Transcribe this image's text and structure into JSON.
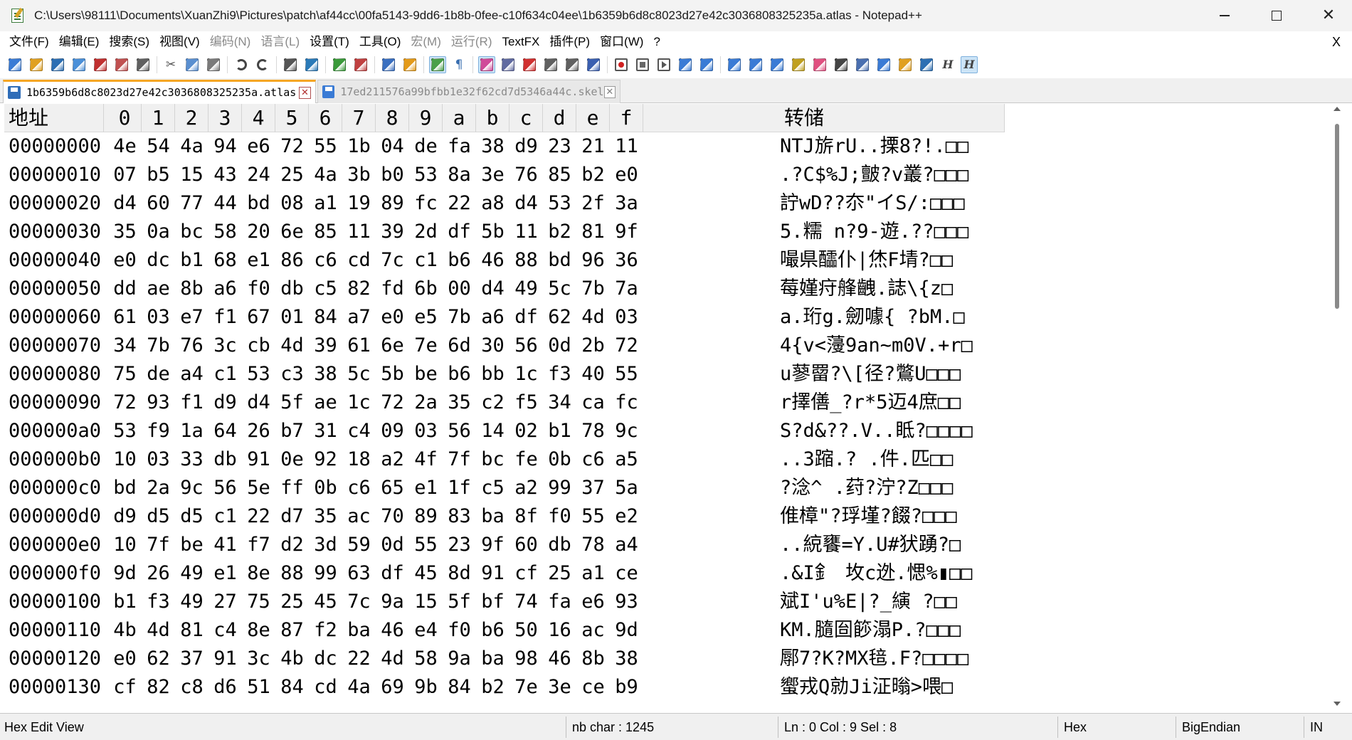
{
  "window": {
    "title": "C:\\Users\\98111\\Documents\\XuanZhi9\\Pictures\\patch\\af44cc\\00fa5143-9dd6-1b8b-0fee-c10f634c04ee\\1b6359b6d8c8023d27e42c3036808325235a.atlas - Notepad++",
    "minimize_glyph": "",
    "close_glyph": "✕"
  },
  "menu": {
    "items": [
      {
        "label": "文件(F)",
        "enabled": true
      },
      {
        "label": "编辑(E)",
        "enabled": true
      },
      {
        "label": "搜索(S)",
        "enabled": true
      },
      {
        "label": "视图(V)",
        "enabled": true
      },
      {
        "label": "编码(N)",
        "enabled": false
      },
      {
        "label": "语言(L)",
        "enabled": false
      },
      {
        "label": "设置(T)",
        "enabled": true
      },
      {
        "label": "工具(O)",
        "enabled": true
      },
      {
        "label": "宏(M)",
        "enabled": false
      },
      {
        "label": "运行(R)",
        "enabled": false
      },
      {
        "label": "TextFX",
        "enabled": true
      },
      {
        "label": "插件(P)",
        "enabled": true
      },
      {
        "label": "窗口(W)",
        "enabled": true
      },
      {
        "label": "?",
        "enabled": true
      }
    ],
    "close_document_glyph": "X"
  },
  "toolbar": {
    "icons": [
      "new-file-icon",
      "open-file-icon",
      "save-icon",
      "save-all-icon",
      "close-icon",
      "close-all-icon",
      "print-icon",
      "|",
      "cut-icon",
      "copy-icon",
      "paste-icon",
      "|",
      "undo-icon",
      "redo-icon",
      "|",
      "find-icon",
      "replace-icon",
      "|",
      "zoom-in-icon",
      "zoom-out-icon",
      "|",
      "sync-vertical-icon",
      "sync-horizontal-icon",
      "|",
      "word-wrap-icon",
      "show-all-chars-icon",
      "|",
      "indent-guide-icon",
      "user-lang-icon",
      "doc-map-icon",
      "function-list-icon",
      "folder-workspace-icon",
      "monitor-icon",
      "|",
      "record-macro-icon",
      "stop-record-icon",
      "play-macro-icon",
      "run-macro-multiple-icon",
      "save-macro-icon",
      "|",
      "plugin-1-icon",
      "plugin-2-icon",
      "plugin-3-icon",
      "plugin-4-icon",
      "plugin-5-icon",
      "plugin-6-icon",
      "plugin-7-icon",
      "plugin-8-icon",
      "plugin-9-icon",
      "plugin-10-icon",
      "hex-editor-h-icon",
      "hex-editor-h-active-icon"
    ],
    "active_icons": [
      "word-wrap-icon",
      "indent-guide-icon",
      "hex-editor-h-active-icon"
    ]
  },
  "tabs": [
    {
      "label": "1b6359b6d8c8023d27e42c3036808325235a.atlas",
      "active": true,
      "close_glyph": "✕"
    },
    {
      "label": "17ed211576a99bfbb1e32f62cd7d5346a44c.skel",
      "active": false,
      "close_glyph": "✕"
    }
  ],
  "hex": {
    "header": {
      "address_label": "地址",
      "columns": [
        "0",
        "1",
        "2",
        "3",
        "4",
        "5",
        "6",
        "7",
        "8",
        "9",
        "a",
        "b",
        "c",
        "d",
        "e",
        "f"
      ],
      "dump_label": "转储"
    },
    "rows": [
      {
        "addr": "00000000",
        "bytes": [
          "4e",
          "54",
          "4a",
          "94",
          "e6",
          "72",
          "55",
          "1b",
          "04",
          "de",
          "fa",
          "38",
          "d9",
          "23",
          "21",
          "11"
        ],
        "dump": "NTJ旂rU..搮8?!.□□"
      },
      {
        "addr": "00000010",
        "bytes": [
          "07",
          "b5",
          "15",
          "43",
          "24",
          "25",
          "4a",
          "3b",
          "b0",
          "53",
          "8a",
          "3e",
          "76",
          "85",
          "b2",
          "e0"
        ],
        "dump": ".?C$%J;皽?v叢?□□□"
      },
      {
        "addr": "00000020",
        "bytes": [
          "d4",
          "60",
          "77",
          "44",
          "bd",
          "08",
          "a1",
          "19",
          "89",
          "fc",
          "22",
          "a8",
          "d4",
          "53",
          "2f",
          "3a"
        ],
        "dump": "詝wD??夵\"イS/:□□□"
      },
      {
        "addr": "00000030",
        "bytes": [
          "35",
          "0a",
          "bc",
          "58",
          "20",
          "6e",
          "85",
          "11",
          "39",
          "2d",
          "df",
          "5b",
          "11",
          "b2",
          "81",
          "9f"
        ],
        "dump": "5.糯 n?9-遊.??□□□"
      },
      {
        "addr": "00000040",
        "bytes": [
          "e0",
          "dc",
          "b1",
          "68",
          "e1",
          "86",
          "c6",
          "cd",
          "7c",
          "c1",
          "b6",
          "46",
          "88",
          "bd",
          "96",
          "36"
        ],
        "dump": "嘬県醽仆|烋F埥?□□"
      },
      {
        "addr": "00000050",
        "bytes": [
          "dd",
          "ae",
          "8b",
          "a6",
          "f0",
          "db",
          "c5",
          "82",
          "fd",
          "6b",
          "00",
          "d4",
          "49",
          "5c",
          "7b",
          "7a"
        ],
        "dump": "莓嫤疛艂齥.誌\\{z□"
      },
      {
        "addr": "00000060",
        "bytes": [
          "61",
          "03",
          "e7",
          "f1",
          "67",
          "01",
          "84",
          "a7",
          "e0",
          "e5",
          "7b",
          "a6",
          "df",
          "62",
          "4d",
          "03"
        ],
        "dump": "a.珩g.劒噱{ ?bM.□"
      },
      {
        "addr": "00000070",
        "bytes": [
          "34",
          "7b",
          "76",
          "3c",
          "cb",
          "4d",
          "39",
          "61",
          "6e",
          "7e",
          "6d",
          "30",
          "56",
          "0d",
          "2b",
          "72"
        ],
        "dump": "4{v<薓9an~m0V.+r□"
      },
      {
        "addr": "00000080",
        "bytes": [
          "75",
          "de",
          "a4",
          "c1",
          "53",
          "c3",
          "38",
          "5c",
          "5b",
          "be",
          "b6",
          "bb",
          "1c",
          "f3",
          "40",
          "55"
        ],
        "dump": "u蓼罶?\\[径?鷩U□□□"
      },
      {
        "addr": "00000090",
        "bytes": [
          "72",
          "93",
          "f1",
          "d9",
          "d4",
          "5f",
          "ae",
          "1c",
          "72",
          "2a",
          "35",
          "c2",
          "f5",
          "34",
          "ca",
          "fc"
        ],
        "dump": "r擇僐_?r*5迈4庶□□"
      },
      {
        "addr": "000000a0",
        "bytes": [
          "53",
          "f9",
          "1a",
          "64",
          "26",
          "b7",
          "31",
          "c4",
          "09",
          "03",
          "56",
          "14",
          "02",
          "b1",
          "78",
          "9c"
        ],
        "dump": "S?d&??.V..眡?□□□□"
      },
      {
        "addr": "000000b0",
        "bytes": [
          "10",
          "03",
          "33",
          "db",
          "91",
          "0e",
          "92",
          "18",
          "a2",
          "4f",
          "7f",
          "bc",
          "fe",
          "0b",
          "c6",
          "a5"
        ],
        "dump": "..3蹜.?  .件.匹□□"
      },
      {
        "addr": "000000c0",
        "bytes": [
          "bd",
          "2a",
          "9c",
          "56",
          "5e",
          "ff",
          "0b",
          "c6",
          "65",
          "e1",
          "1f",
          "c5",
          "a2",
          "99",
          "37",
          "5a"
        ],
        "dump": "?淰^  .荮?泞?Z□□□"
      },
      {
        "addr": "000000d0",
        "bytes": [
          "d9",
          "d5",
          "d5",
          "c1",
          "22",
          "d7",
          "35",
          "ac",
          "70",
          "89",
          "83",
          "ba",
          "8f",
          "f0",
          "55",
          "e2"
        ],
        "dump": "倠樟\"?琈墐?餟?□□□"
      },
      {
        "addr": "000000e0",
        "bytes": [
          "10",
          "7f",
          "be",
          "41",
          "f7",
          "d2",
          "3d",
          "59",
          "0d",
          "55",
          "23",
          "9f",
          "60",
          "db",
          "78",
          "a4"
        ],
        "dump": "..綂饔=Y.U#犾踴?□"
      },
      {
        "addr": "000000f0",
        "bytes": [
          "9d",
          "26",
          "49",
          "e1",
          "8e",
          "88",
          "99",
          "63",
          "df",
          "45",
          "8d",
          "91",
          "cf",
          "25",
          "a1",
          "ce"
        ],
        "dump": ".&I釒 坆c迯.愢%▮□□"
      },
      {
        "addr": "00000100",
        "bytes": [
          "b1",
          "f3",
          "49",
          "27",
          "75",
          "25",
          "45",
          "7c",
          "9a",
          "15",
          "5f",
          "bf",
          "74",
          "fa",
          "e6",
          "93"
        ],
        "dump": "斌I'u%E|?_縯  ?□□"
      },
      {
        "addr": "00000110",
        "bytes": [
          "4b",
          "4d",
          "81",
          "c4",
          "8e",
          "87",
          "f2",
          "ba",
          "46",
          "e4",
          "f0",
          "b6",
          "50",
          "16",
          "ac",
          "9d"
        ],
        "dump": "KM.膸囼篎溻P.?□□□"
      },
      {
        "addr": "00000120",
        "bytes": [
          "e0",
          "62",
          "37",
          "91",
          "3c",
          "4b",
          "dc",
          "22",
          "4d",
          "58",
          "9a",
          "ba",
          "98",
          "46",
          "8b",
          "38"
        ],
        "dump": "鄏7?K?MX毰.F?□□□□"
      },
      {
        "addr": "00000130",
        "bytes": [
          "cf",
          "82",
          "c8",
          "d6",
          "51",
          "84",
          "cd",
          "4a",
          "69",
          "9b",
          "84",
          "b2",
          "7e",
          "3e",
          "ce",
          "b9"
        ],
        "dump": "蠁戎Q勍Ji泟暡>喂□"
      }
    ]
  },
  "status": {
    "view": "Hex Edit View",
    "nb_char": "nb char : 1245",
    "position": "Ln : 0    Col : 9    Sel : 8",
    "mode": "Hex",
    "endian": "BigEndian",
    "ins": "IN"
  }
}
